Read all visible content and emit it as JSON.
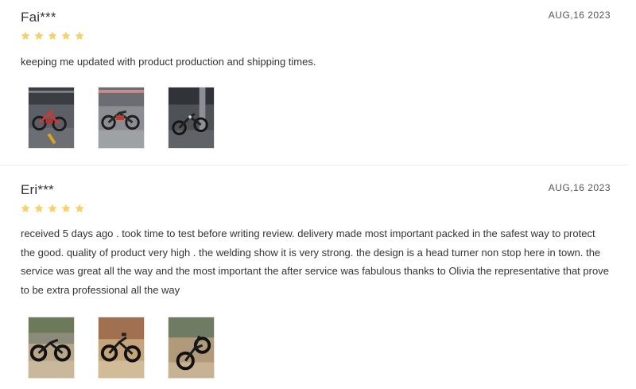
{
  "reviews": [
    {
      "author": "Fai***",
      "date": "AUG,16 2023",
      "rating": 5,
      "text": "keeping me updated with product production and shipping times.",
      "photos": [
        "garage-bike-photo",
        "garage-bike-photo",
        "garage-bike-photo"
      ]
    },
    {
      "author": "Eri***",
      "date": "AUG,16 2023",
      "rating": 5,
      "text": "received 5 days ago . took time to test before writing review. delivery made most important packed in the safest way to protect the good. quality of product very high . the welding show it is very strong. the design is a head turner non stop here in town. the service was great all the way and the most important the after service was fabulous thanks to Olivia the representative that prove to be extra professional all the way",
      "photos": [
        "outdoor-bike-photo",
        "outdoor-bike-photo",
        "outdoor-bike-photo"
      ]
    }
  ],
  "colors": {
    "star": "#f5d26b",
    "text": "#333333",
    "date": "#555555",
    "divider": "#ededed"
  },
  "icons": {
    "star": "star-icon"
  }
}
